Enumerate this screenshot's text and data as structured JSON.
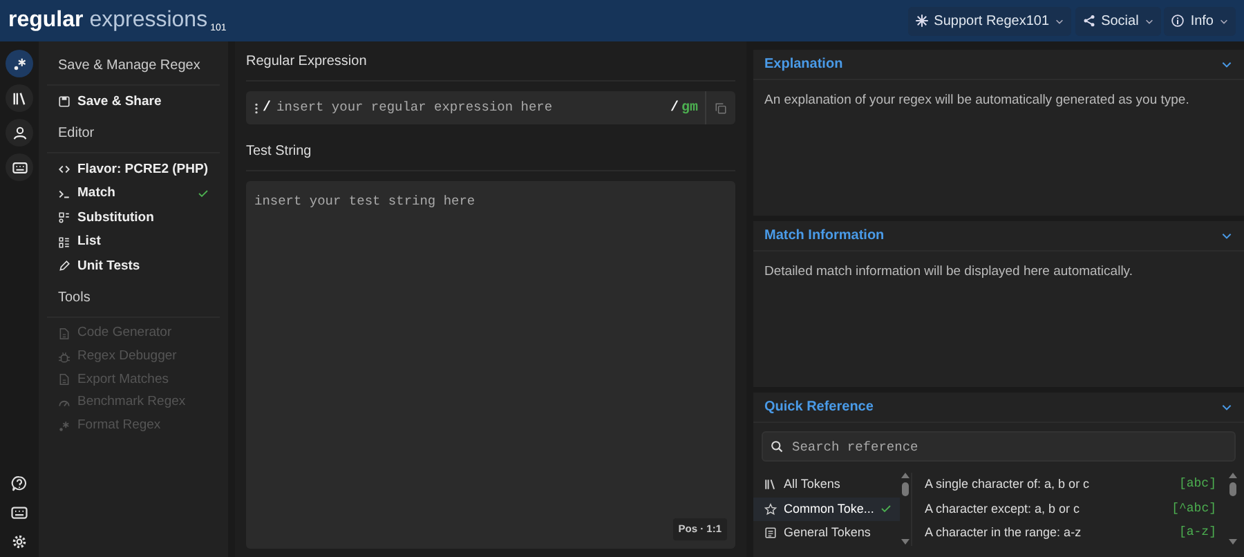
{
  "header": {
    "logo": {
      "main": "regular",
      "sub": "expressions",
      "sup": "101"
    },
    "menus": [
      {
        "label": "Support Regex101"
      },
      {
        "label": "Social"
      },
      {
        "label": "Info"
      }
    ]
  },
  "rail": {
    "top": [
      {
        "selected": true
      },
      {
        "selected": false
      },
      {
        "selected": false
      },
      {
        "selected": false
      }
    ]
  },
  "sidebar": {
    "sections": [
      {
        "title": "Save & Manage Regex",
        "items": [
          {
            "label": "Save & Share",
            "checked": false,
            "disabled": false
          }
        ]
      },
      {
        "title": "Editor",
        "items": [
          {
            "label": "Flavor: PCRE2 (PHP)",
            "checked": false,
            "disabled": false
          },
          {
            "label": "Match",
            "checked": true,
            "disabled": false
          },
          {
            "label": "Substitution",
            "checked": false,
            "disabled": false
          },
          {
            "label": "List",
            "checked": false,
            "disabled": false
          },
          {
            "label": "Unit Tests",
            "checked": false,
            "disabled": false
          }
        ]
      },
      {
        "title": "Tools",
        "items": [
          {
            "label": "Code Generator",
            "checked": false,
            "disabled": true
          },
          {
            "label": "Regex Debugger",
            "checked": false,
            "disabled": true
          },
          {
            "label": "Export Matches",
            "checked": false,
            "disabled": true
          },
          {
            "label": "Benchmark Regex",
            "checked": false,
            "disabled": true
          },
          {
            "label": "Format Regex",
            "checked": false,
            "disabled": true
          }
        ]
      }
    ]
  },
  "regex": {
    "title": "Regular Expression",
    "open_delimiter": "/",
    "placeholder": "insert your regular expression here",
    "close_delimiter": "/",
    "flags": "gm"
  },
  "test_string": {
    "title": "Test String",
    "placeholder": "insert your test string here",
    "position": "Pos · 1:1"
  },
  "panels": [
    {
      "title": "Explanation",
      "expanded": true,
      "text": "An explanation of your regex will be automatically generated as you type."
    },
    {
      "title": "Match Information",
      "expanded": true,
      "text": "Detailed match information will be displayed here automatically."
    }
  ],
  "quick_reference": {
    "title": "Quick Reference",
    "expanded": true,
    "search_placeholder": "Search reference",
    "categories": [
      {
        "label": "All Tokens",
        "selected": false
      },
      {
        "label": "Common Toke...",
        "selected": true
      },
      {
        "label": "General Tokens",
        "selected": false
      }
    ],
    "tokens": [
      {
        "description": "A single character of: a, b or c",
        "token": "[abc]"
      },
      {
        "description": "A character except: a, b or c",
        "token": "[^abc]"
      },
      {
        "description": "A character in the range: a-z",
        "token": "[a-z]"
      }
    ]
  }
}
